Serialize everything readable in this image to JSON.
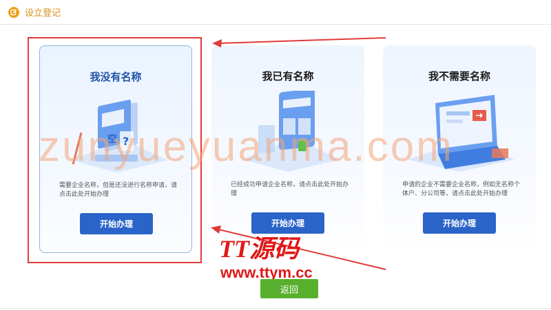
{
  "header": {
    "title": "设立登记",
    "icon": "edit-icon"
  },
  "cards": [
    {
      "title": "我没有名称",
      "description": "需要企业名称，但是还没进行名称申请，请点击此处开始办理",
      "button": "开始办理",
      "icon": "clipboard-illustration-icon",
      "selected": true
    },
    {
      "title": "我已有名称",
      "description": "已经成功申请企业名称，请点击此处开始办理",
      "button": "开始办理",
      "icon": "tablet-illustration-icon",
      "selected": false
    },
    {
      "title": "我不需要名称",
      "description": "申请的企业不需要企业名称，例如无名称个体户、分公司等，请点击此处开始办理",
      "button": "开始办理",
      "icon": "laptop-illustration-icon",
      "selected": false
    }
  ],
  "watermark": "zunyueyuanma.com",
  "logo": {
    "main": "TT源码",
    "url": "www.ttym.cc"
  },
  "back_button": "返回",
  "colors": {
    "primary": "#2a64c8",
    "back": "#58b02e",
    "header_accent": "#f0a21c",
    "annotation": "#e03a3a"
  }
}
